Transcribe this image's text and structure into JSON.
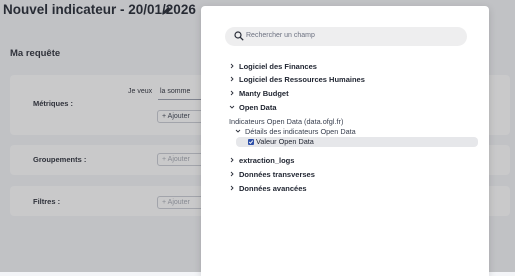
{
  "page": {
    "title": "Nouvel indicateur - 20/01/2026"
  },
  "request": {
    "title": "Ma requête",
    "metrics_label": "Métriques :",
    "je_veux": "Je veux",
    "aggregation": "la somme",
    "add_label": "Ajouter",
    "groups_label": "Groupements :",
    "groups_add": "Ajouter",
    "filters_label": "Filtres :",
    "filters_add": "Ajouter"
  },
  "modal": {
    "search_placeholder": "Rechercher un champ",
    "categories": [
      {
        "label": "Logiciel des Finances",
        "expanded": false
      },
      {
        "label": "Logiciel des Ressources Humaines",
        "expanded": false
      },
      {
        "label": "Manty Budget",
        "expanded": false
      },
      {
        "label": "Open Data",
        "expanded": true
      },
      {
        "label": "extraction_logs",
        "expanded": false
      },
      {
        "label": "Données transverses",
        "expanded": false
      },
      {
        "label": "Données avancées",
        "expanded": false
      }
    ],
    "open_data": {
      "source": "Indicateurs Open Data (data.ofgl.fr)",
      "group": "Détails des indicateurs Open Data",
      "field": "Valeur Open Data",
      "field_checked": true
    }
  },
  "colors": {
    "accent": "#2d4fa8",
    "overlay": "#3c3c42"
  }
}
